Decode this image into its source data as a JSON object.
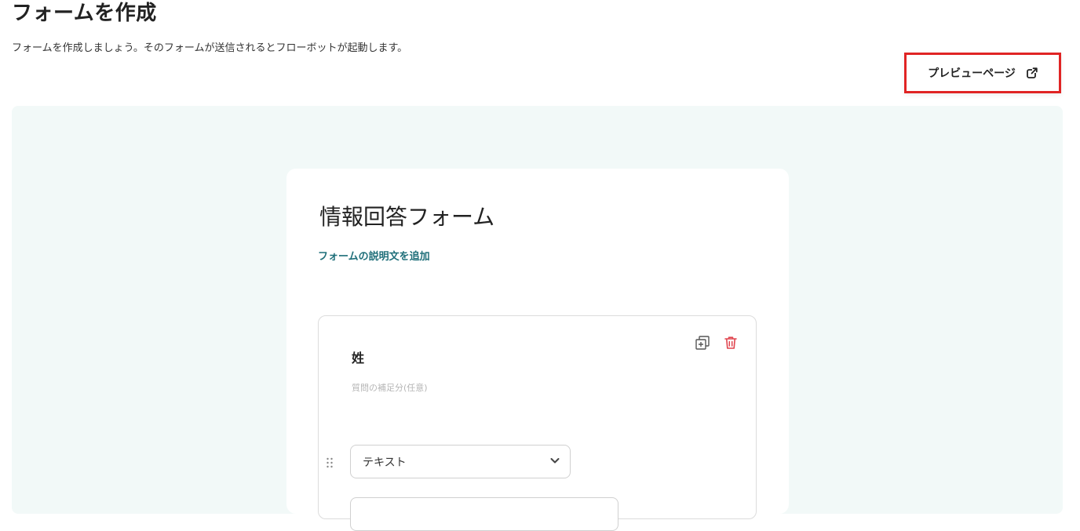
{
  "page": {
    "title": "フォームを作成",
    "description": "フォームを作成しましょう。そのフォームが送信されるとフローボットが起動します。"
  },
  "toolbar": {
    "preview_label": "プレビューページ",
    "preview_icon": "external-link-icon",
    "highlight_color": "#e02424"
  },
  "form": {
    "title": "情報回答フォーム",
    "add_description_label": "フォームの説明文を追加",
    "questions": [
      {
        "label": "姓",
        "hint_placeholder": "質問の補足分(任意)",
        "type_value": "テキスト",
        "icons": [
          "duplicate-icon",
          "trash-icon",
          "drag-handle-icon",
          "chevron-down-icon"
        ]
      }
    ]
  },
  "colors": {
    "canvas_bg": "#f2f9f8",
    "link": "#1f6f7a",
    "delete": "#e0454f"
  }
}
